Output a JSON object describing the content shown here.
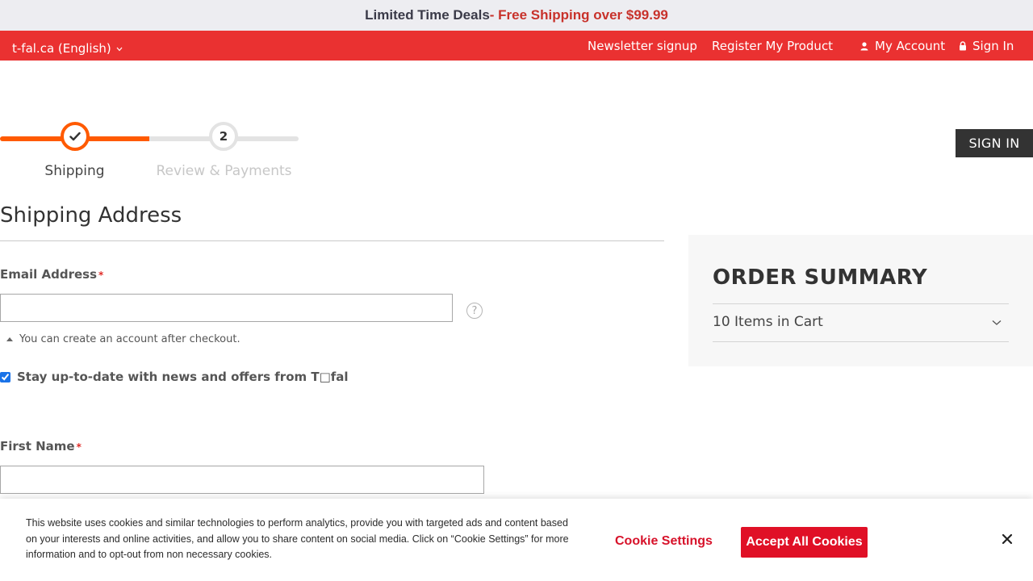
{
  "promo": {
    "main": "Limited Time Deals",
    "accent": " - Free Shipping over $99.99"
  },
  "top_nav": {
    "locale": "t-fal.ca (English)",
    "newsletter": "Newsletter signup",
    "register": "Register My Product",
    "account": "My Account",
    "signin": "Sign In"
  },
  "progress": {
    "step1_label": "Shipping",
    "step2_number": "2",
    "step2_label": "Review & Payments"
  },
  "signin_button": "SIGN IN",
  "form": {
    "title": "Shipping Address",
    "email_label": "Email Address",
    "required_mark": "*",
    "email_value": "",
    "help_glyph": "?",
    "account_note": "You can create an account after checkout.",
    "newsletter_opt_label": "Stay up-to-date with news and offers from T□fal",
    "newsletter_checked": true,
    "first_name_label": "First Name",
    "first_name_value": ""
  },
  "order_summary": {
    "title": "ORDER SUMMARY",
    "items": "10 Items in Cart"
  },
  "cookie": {
    "text": "This website uses cookies and similar technologies to perform analytics, provide you with targeted ads and content based on your interests and online activities, and allow you to share content on social media. Click on “Cookie Settings” for more information and to opt-out from non necessary cookies.",
    "settings": "Cookie Settings",
    "accept": "Accept All Cookies"
  },
  "colors": {
    "nav_red": "#ea3131",
    "progress_orange": "#ff5a00",
    "cookie_red": "#e01026",
    "promo_accent": "#c8322b"
  }
}
